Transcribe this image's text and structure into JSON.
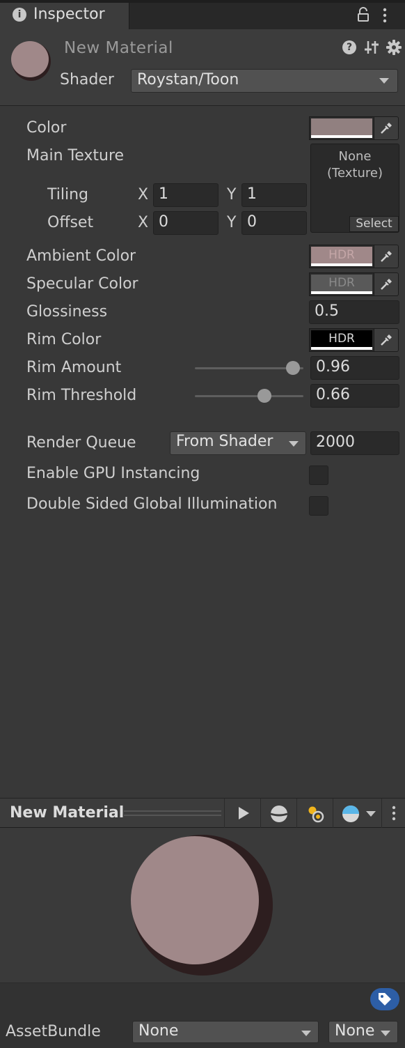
{
  "tab": {
    "label": "Inspector"
  },
  "material": {
    "name": "New Material",
    "shader_label": "Shader",
    "shader_value": "Roystan/Toon"
  },
  "properties": {
    "color_label": "Color",
    "main_texture_label": "Main Texture",
    "texture_slot": {
      "value": "None\n(Texture)",
      "select_label": "Select"
    },
    "tiling_label": "Tiling",
    "offset_label": "Offset",
    "tiling": {
      "x_label": "X",
      "x": "1",
      "y_label": "Y",
      "y": "1"
    },
    "offset": {
      "x_label": "X",
      "x": "0",
      "y_label": "Y",
      "y": "0"
    },
    "ambient_color_label": "Ambient Color",
    "specular_color_label": "Specular Color",
    "glossiness_label": "Glossiness",
    "glossiness": "0.5",
    "rim_color_label": "Rim Color",
    "rim_amount_label": "Rim Amount",
    "rim_amount": "0.96",
    "rim_amount_fraction": 0.96,
    "rim_threshold_label": "Rim Threshold",
    "rim_threshold": "0.66",
    "rim_threshold_fraction": 0.66,
    "hdr_label": "HDR",
    "render_queue_label": "Render Queue",
    "render_queue_mode": "From Shader",
    "render_queue_value": "2000",
    "gpu_instancing_label": "Enable GPU Instancing",
    "gpu_instancing_checked": false,
    "double_sided_gi_label": "Double Sided Global Illumination",
    "double_sided_gi_checked": false
  },
  "colors": {
    "main_color": "#918080",
    "ambient_color": "#a08889",
    "specular_color": "#595959",
    "rim_color": "#000000",
    "material_sphere": "#a08889",
    "material_shadow": "#2d1e1f",
    "accent_tag": "#2d5ea6"
  },
  "preview": {
    "title": "New Material",
    "icons": [
      "play-icon",
      "sphere-mesh-icon",
      "light-icon",
      "skybox-sphere-icon",
      "kebab-menu-icon"
    ]
  },
  "asset_bundle": {
    "label": "AssetBundle",
    "name_value": "None",
    "variant_value": "None"
  }
}
